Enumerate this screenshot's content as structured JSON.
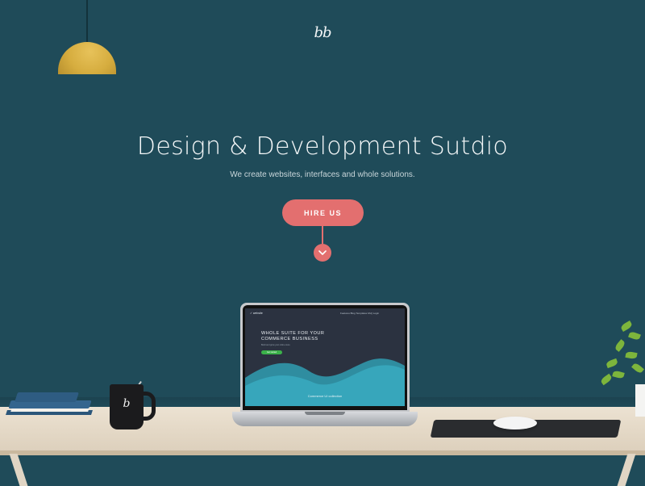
{
  "brand": {
    "logo_text": "bb",
    "mug_logo_text": "b"
  },
  "hero": {
    "title": "Design & Development Sutdio",
    "subtitle": "We create websites, interfaces and whole solutions.",
    "cta_label": "HIRE US"
  },
  "laptop_screen": {
    "logo": "✓ website",
    "nav": "Features   Blog   Templates   FAQ   Login",
    "headline": "WHOLE SUITE FOR YOUR COMMERCE BUSINESS",
    "subtext": "Build and grow your online store",
    "cta": "Get started",
    "footer": "Commerce UI collection"
  },
  "colors": {
    "wall": "#1f4b59",
    "accent": "#e36f6f",
    "desk": "#e6dccb",
    "lamp": "#d6ad3f"
  },
  "icons": {
    "scroll": "chevron-down-icon",
    "lamp": "pendant-lamp-icon"
  }
}
